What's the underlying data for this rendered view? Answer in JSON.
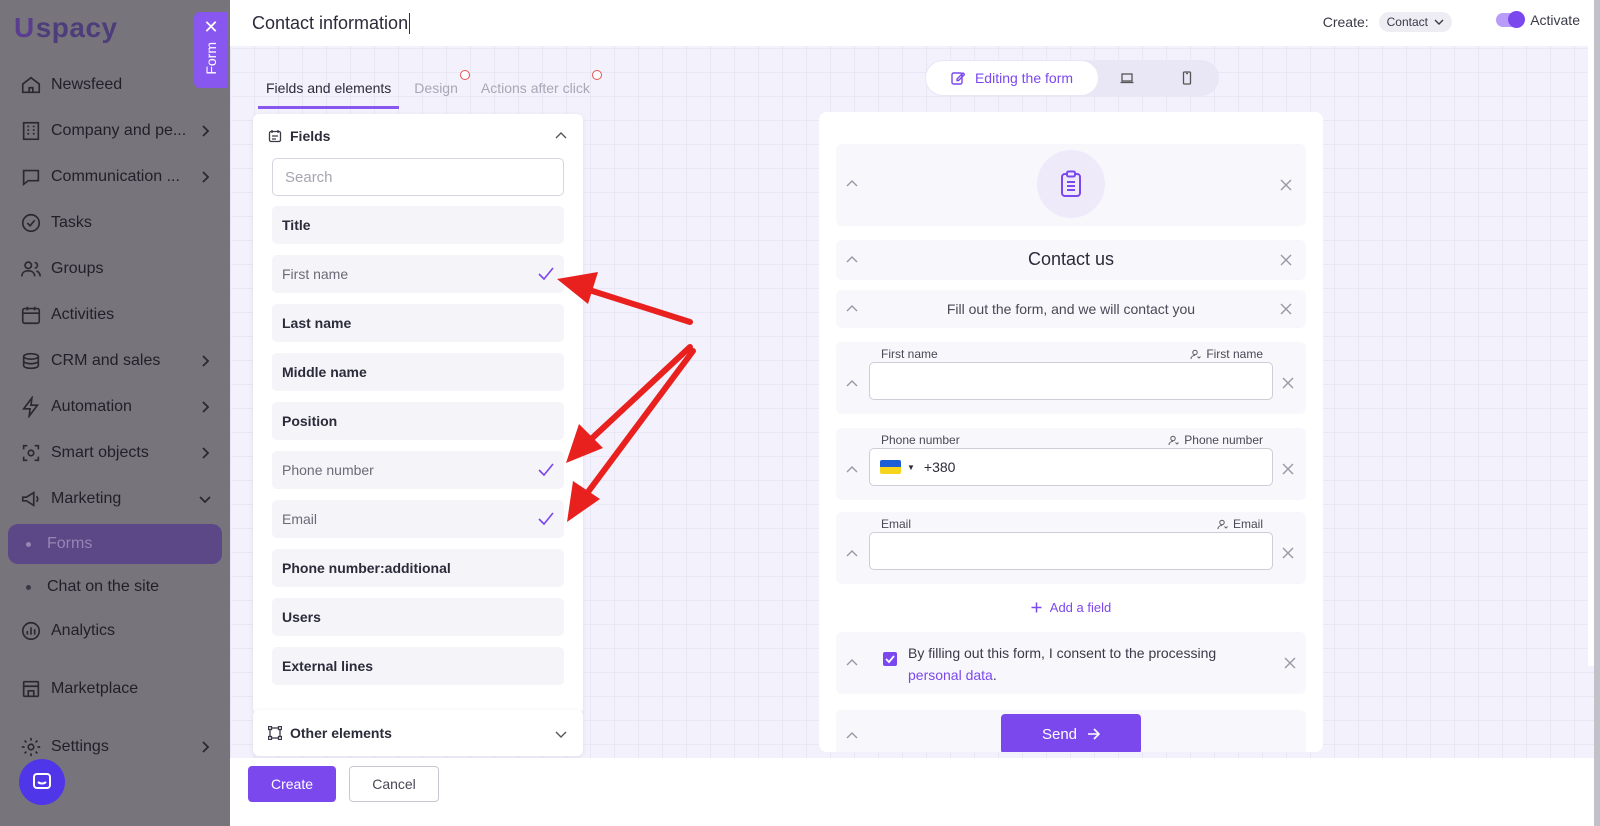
{
  "app": {
    "logo_u": "U",
    "logo_text": "spacy",
    "nav": [
      {
        "label": "Newsfeed",
        "icon": "home-icon",
        "chevron": false
      },
      {
        "label": "Company and pe...",
        "icon": "building-icon",
        "chevron": true
      },
      {
        "label": "Communication ...",
        "icon": "chat-icon",
        "chevron": true
      },
      {
        "label": "Tasks",
        "icon": "check-circle-icon",
        "chevron": false
      },
      {
        "label": "Groups",
        "icon": "users-icon",
        "chevron": false
      },
      {
        "label": "Activities",
        "icon": "calendar-icon",
        "chevron": false
      },
      {
        "label": "CRM and sales",
        "icon": "coins-icon",
        "chevron": true
      },
      {
        "label": "Automation",
        "icon": "bolt-icon",
        "chevron": true
      },
      {
        "label": "Smart objects",
        "icon": "smart-object-icon",
        "chevron": true
      },
      {
        "label": "Marketing",
        "icon": "megaphone-icon",
        "chevron": "down"
      }
    ],
    "sub_nav": [
      {
        "label": "Forms",
        "active": true
      },
      {
        "label": "Chat on the site",
        "active": false
      }
    ],
    "nav_bottom": [
      {
        "label": "Analytics",
        "icon": "chart-icon",
        "chevron": false
      },
      {
        "label": "Marketplace",
        "icon": "store-icon",
        "chevron": false
      },
      {
        "label": "Settings",
        "icon": "gear-icon",
        "chevron": true
      }
    ]
  },
  "form_tab": {
    "label": "Form",
    "close": "✕"
  },
  "header": {
    "title": "Contact information",
    "create_label": "Create:",
    "create_value": "Contact",
    "activate_label": "Activate",
    "activate_on": true
  },
  "tabs": [
    {
      "label": "Fields and elements",
      "active": true,
      "badge": false
    },
    {
      "label": "Design",
      "active": false,
      "badge": true
    },
    {
      "label": "Actions after click",
      "active": false,
      "badge": true
    }
  ],
  "fields_panel": {
    "title": "Fields",
    "search_placeholder": "Search",
    "items": [
      {
        "label": "Title",
        "checked": false
      },
      {
        "label": "First name",
        "checked": true
      },
      {
        "label": "Last name",
        "checked": false
      },
      {
        "label": "Middle name",
        "checked": false
      },
      {
        "label": "Position",
        "checked": false
      },
      {
        "label": "Phone number",
        "checked": true
      },
      {
        "label": "Email",
        "checked": true
      },
      {
        "label": "Phone number:additional",
        "checked": false
      },
      {
        "label": "Users",
        "checked": false
      },
      {
        "label": "External lines",
        "checked": false
      }
    ]
  },
  "other_elements": {
    "title": "Other elements"
  },
  "view_switch": {
    "editing_label": "Editing the form"
  },
  "preview": {
    "title": "Contact us",
    "subtitle": "Fill out the form, and we will contact you",
    "fields": [
      {
        "label": "First name",
        "mapped": "First name",
        "value": ""
      },
      {
        "label": "Phone number",
        "mapped": "Phone number",
        "value": "+380"
      },
      {
        "label": "Email",
        "mapped": "Email",
        "value": ""
      }
    ],
    "add_field_label": "Add a field",
    "consent_text": "By filling out this form, I consent to the processing",
    "consent_link": "personal data",
    "consent_end": ".",
    "send_label": "Send"
  },
  "footer": {
    "create_label": "Create",
    "cancel_label": "Cancel"
  },
  "colors": {
    "accent": "#7b48ee",
    "arrow": "#e8211f",
    "sidebar_dim": "#78747c"
  }
}
